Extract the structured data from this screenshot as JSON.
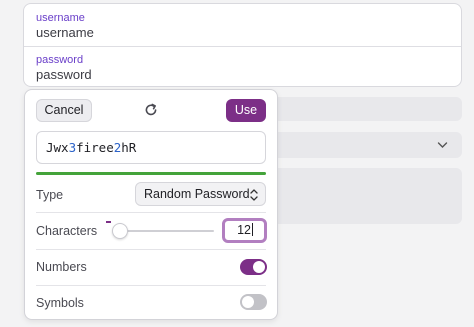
{
  "login": {
    "username_label": "username",
    "username_value": "username",
    "password_label": "password",
    "password_value": "password"
  },
  "generator": {
    "cancel_label": "Cancel",
    "use_label": "Use",
    "password_parts": [
      {
        "text": "Jwx",
        "kind": "letter"
      },
      {
        "text": "3",
        "kind": "digit"
      },
      {
        "text": "firee",
        "kind": "letter"
      },
      {
        "text": "2",
        "kind": "digit"
      },
      {
        "text": "hR",
        "kind": "letter"
      }
    ],
    "strength_fraction": 1.0,
    "type_label": "Type",
    "type_value": "Random Password",
    "characters_label": "Characters",
    "characters_value": "12",
    "characters_minus": "-",
    "characters_slider_fraction": 0.06,
    "numbers_label": "Numbers",
    "numbers_enabled": true,
    "symbols_label": "Symbols",
    "symbols_enabled": false
  },
  "colors": {
    "accent": "#7c2f87",
    "strength": "#44a33a",
    "digit": "#2c63c9",
    "field_label": "#6a3fc9"
  },
  "icons": [
    "regenerate-icon",
    "up-down-chevron-icon",
    "chevron-down-icon"
  ]
}
